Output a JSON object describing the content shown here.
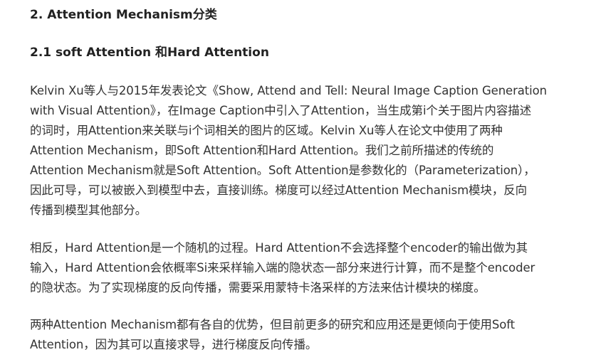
{
  "article": {
    "section_heading": "2. Attention Mechanism分类",
    "subsection_heading": "2.1 soft Attention 和Hard Attention",
    "paragraphs": [
      {
        "lines": [
          "Kelvin Xu等人与2015年发表论文《Show, Attend and Tell: Neural Image Caption Generation",
          "with Visual Attention》，在Image Caption中引入了Attention，当生成第i个关于图片内容描述",
          "的词时，用Attention来关联与i个词相关的图片的区域。Kelvin Xu等人在论文中使用了两种",
          "Attention Mechanism，即Soft Attention和Hard Attention。我们之前所描述的传统的",
          "Attention Mechanism就是Soft Attention。Soft Attention是参数化的（Parameterization），",
          "因此可导，可以被嵌入到模型中去，直接训练。梯度可以经过Attention Mechanism模块，反向",
          "传播到模型其他部分。"
        ]
      },
      {
        "lines": [
          "相反，Hard Attention是一个随机的过程。Hard Attention不会选择整个encoder的输出做为其",
          "输入，Hard Attention会依概率Si来采样输入端的隐状态一部分来进行计算，而不是整个encoder",
          "的隐状态。为了实现梯度的反向传播，需要采用蒙特卡洛采样的方法来估计模块的梯度。"
        ]
      },
      {
        "lines": [
          "两种Attention Mechanism都有各自的优势，但目前更多的研究和应用还是更倾向于使用Soft",
          "Attention，因为其可以直接求导，进行梯度反向传播。"
        ]
      }
    ]
  }
}
